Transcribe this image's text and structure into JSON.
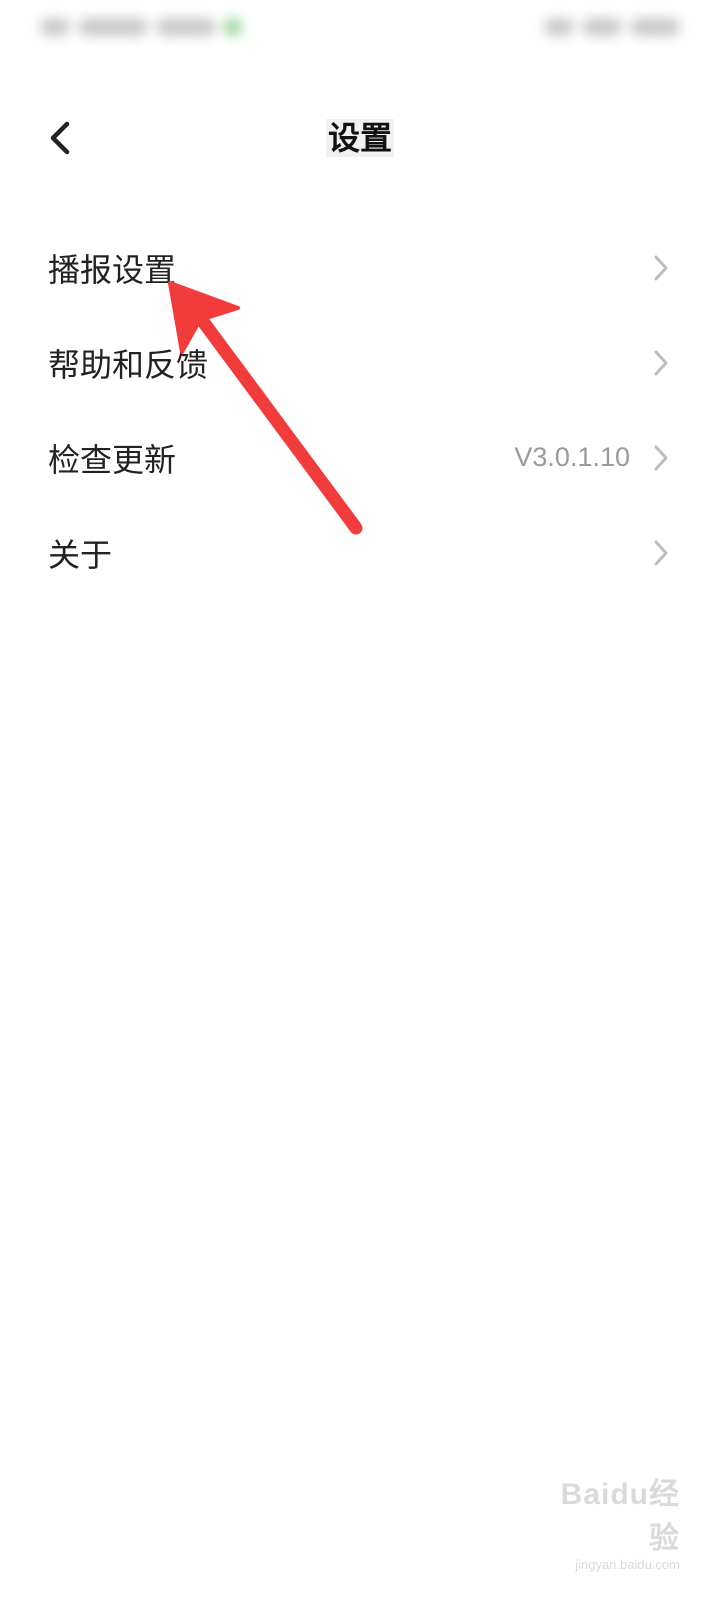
{
  "header": {
    "title": "设置"
  },
  "menu": {
    "items": [
      {
        "label": "播报设置",
        "value": ""
      },
      {
        "label": "帮助和反馈",
        "value": ""
      },
      {
        "label": "检查更新",
        "value": "V3.0.1.10"
      },
      {
        "label": "关于",
        "value": ""
      }
    ]
  },
  "watermark": {
    "logo": "Baidu经验",
    "sub": "jingyan.baidu.com"
  },
  "colors": {
    "annotation_arrow": "#f23b3b",
    "chevron": "#bdbdbd",
    "value_text": "#9a9a9a"
  },
  "icons": {
    "back": "chevron-left-icon",
    "item_arrow": "chevron-right-icon"
  }
}
